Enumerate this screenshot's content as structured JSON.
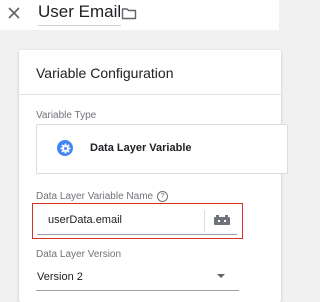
{
  "header": {
    "title": "User Email",
    "close_icon": "close-icon",
    "folder_icon": "folder-icon"
  },
  "card": {
    "title": "Variable Configuration",
    "variable_type": {
      "label": "Variable Type",
      "selected": "Data Layer Variable",
      "icon": "gear-icon",
      "icon_color": "#4285f4"
    },
    "name_field": {
      "label": "Data Layer Variable Name",
      "help_glyph": "?",
      "value": "userData.email",
      "highlight_color": "#d93025",
      "button_icon": "variable-picker-icon"
    },
    "version_field": {
      "label": "Data Layer Version",
      "value": "Version 2"
    }
  }
}
